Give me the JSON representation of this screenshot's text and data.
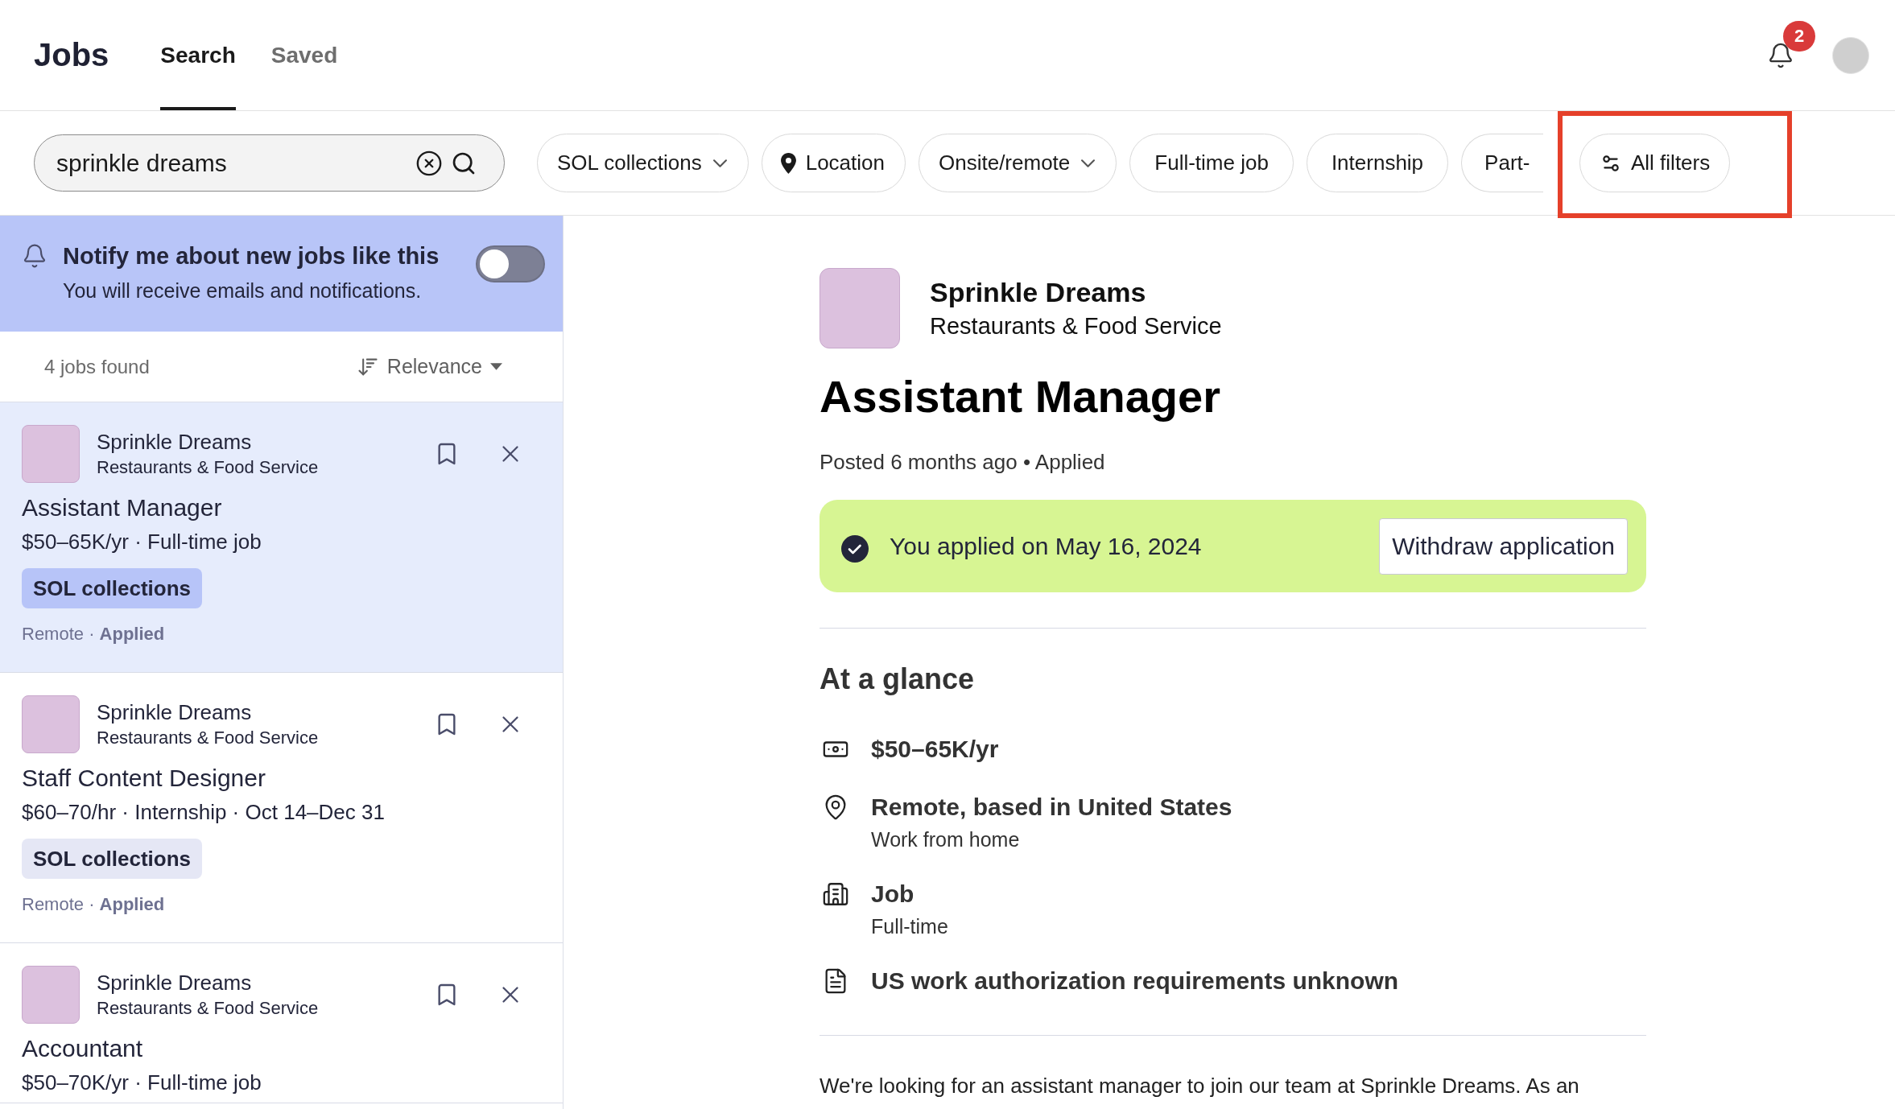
{
  "header": {
    "title": "Jobs",
    "tabs": [
      {
        "label": "Search",
        "selected": true
      },
      {
        "label": "Saved",
        "selected": false
      }
    ],
    "notifications": {
      "count": "2"
    }
  },
  "filter_bar": {
    "search": {
      "value": "sprinkle dreams"
    },
    "chips": [
      {
        "label": "SOL collections",
        "kind": "dropdown"
      },
      {
        "label": "Location",
        "kind": "location"
      },
      {
        "label": "Onsite/remote",
        "kind": "dropdown"
      },
      {
        "label": "Full-time job",
        "kind": "plain"
      },
      {
        "label": "Internship",
        "kind": "plain"
      },
      {
        "label": "Part-",
        "kind": "cut"
      }
    ],
    "all_filters": {
      "label": "All filters",
      "highlighted": true
    }
  },
  "alert": {
    "title": "Notify me about new jobs like this",
    "subtitle": "You will receive emails and notifications.",
    "on": false
  },
  "results": {
    "count": "4 jobs found",
    "sort": "Relevance",
    "jobs": [
      {
        "company": "Sprinkle Dreams",
        "industry": "Restaurants & Food Service",
        "title": "Assistant Manager",
        "meta": "$50–65K/yr · Full-time job",
        "tag": "SOL collections",
        "footer": "Remote · **Applied**",
        "selected": true
      },
      {
        "company": "Sprinkle Dreams",
        "industry": "Restaurants & Food Service",
        "title": "Staff Content Designer",
        "meta": "$60–70/hr · Internship · Oct 14–Dec 31",
        "tag": "SOL collections",
        "footer": "Remote · **Applied**",
        "selected": false
      },
      {
        "company": "Sprinkle Dreams",
        "industry": "Restaurants & Food Service",
        "title": "Accountant",
        "meta": "$50–70K/yr · Full-time job",
        "selected": false
      }
    ]
  },
  "detail": {
    "company": "Sprinkle Dreams",
    "industry": "Restaurants & Food Service",
    "title": "Assistant Manager",
    "posted": "Posted 6 months ago • Applied",
    "applied_banner": {
      "text": "You applied on May 16, 2024",
      "button": "Withdraw application"
    },
    "glance": {
      "heading": "At a glance",
      "items": [
        {
          "kind": "salary",
          "title": "$50–65K/yr"
        },
        {
          "kind": "location",
          "title": "Remote, based in United States",
          "subtitle": "Work from home"
        },
        {
          "kind": "job_type",
          "title": "Job",
          "subtitle": "Full-time"
        },
        {
          "kind": "authorization",
          "title": "US work authorization requirements unknown"
        }
      ]
    },
    "description": "We're looking for an assistant manager to join our team at Sprinkle Dreams. As an"
  }
}
